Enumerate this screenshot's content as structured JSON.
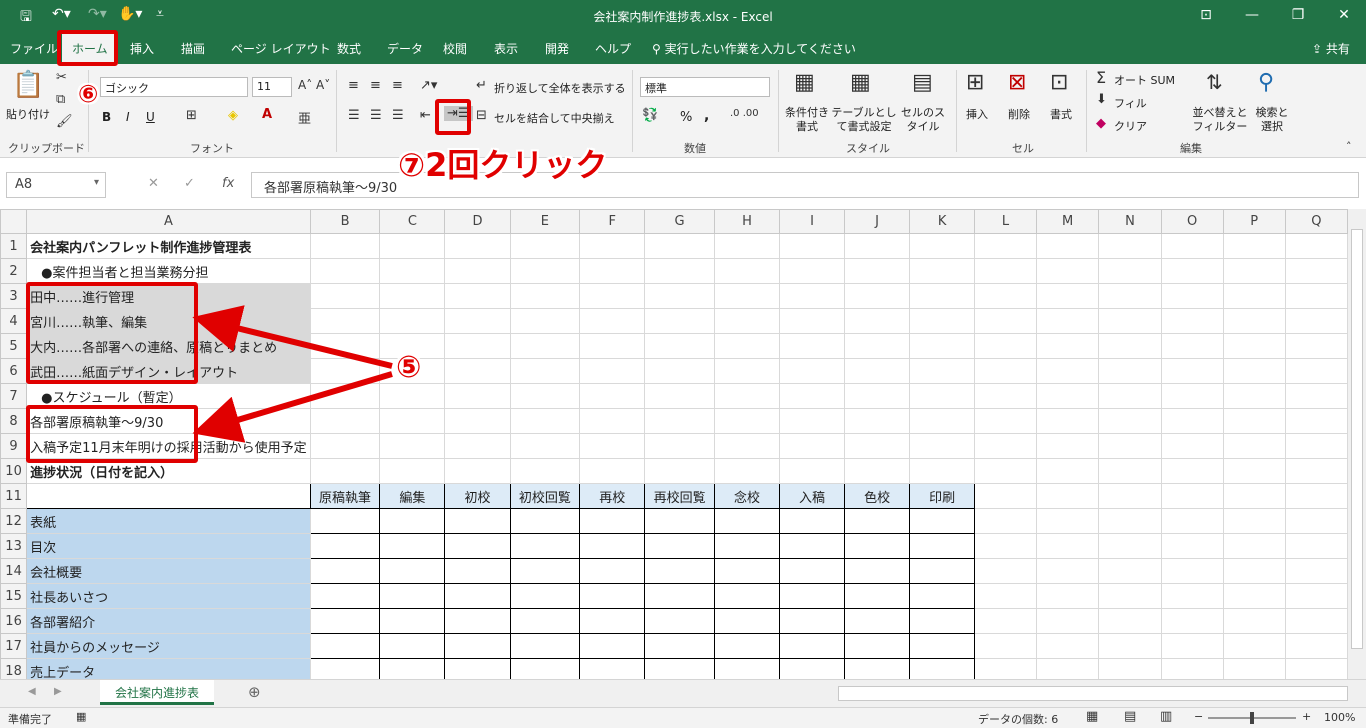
{
  "window": {
    "title": "会社案内制作進捗表.xlsx  -  Excel"
  },
  "menu": {
    "tabs": [
      "ファイル",
      "ホーム",
      "挿入",
      "描画",
      "ページ レイアウト",
      "数式",
      "データ",
      "校閲",
      "表示",
      "開発",
      "ヘルプ"
    ],
    "tell_me": "実行したい作業を入力してください",
    "share": "共有"
  },
  "ribbon": {
    "clipboard": {
      "paste": "貼り付け",
      "group": "クリップボード"
    },
    "font": {
      "name": "ゴシック",
      "size": "11",
      "group": "フォント",
      "bold": "B",
      "italic": "I",
      "underline": "U"
    },
    "alignment": {
      "wrap": "折り返して全体を表示する",
      "merge": "セルを結合して中央揃え"
    },
    "number": {
      "format": "標準",
      "group": "数値",
      "percent": "%",
      "comma": ","
    },
    "styles": {
      "conditional": "条件付き書式",
      "table": "テーブルとして書式設定",
      "cell": "セルのスタイル",
      "group": "スタイル"
    },
    "cells": {
      "insert": "挿入",
      "delete": "削除",
      "format": "書式",
      "group": "セル"
    },
    "editing": {
      "autosum": "オート SUM",
      "fill": "フィル",
      "clear": "クリア",
      "sort": "並べ替えとフィルター",
      "find": "検索と選択",
      "group": "編集"
    }
  },
  "formula": {
    "namebox": "A8",
    "fx": "fx",
    "content": "各部署原稿執筆～9/30"
  },
  "columns": [
    "A",
    "B",
    "C",
    "D",
    "E",
    "F",
    "G",
    "H",
    "I",
    "J",
    "K",
    "L",
    "M",
    "N",
    "O",
    "P",
    "Q"
  ],
  "rows": [
    {
      "n": "1",
      "a": "会社案内パンフレット制作進捗管理表"
    },
    {
      "n": "2",
      "a": "●案件担当者と担当業務分担"
    },
    {
      "n": "3",
      "a": "田中……進行管理"
    },
    {
      "n": "4",
      "a": "宮川……執筆、編集"
    },
    {
      "n": "5",
      "a": "大内……各部署への連絡、原稿とりまとめ"
    },
    {
      "n": "6",
      "a": "武田……紙面デザイン・レイアウト"
    },
    {
      "n": "7",
      "a": "●スケジュール（暫定）"
    },
    {
      "n": "8",
      "a": "各部署原稿執筆～9/30"
    },
    {
      "n": "9",
      "a": "入稿予定11月末年明けの採用活動から使用予定"
    },
    {
      "n": "10",
      "a": "進捗状況（日付を記入）"
    },
    {
      "n": "11",
      "a": ""
    },
    {
      "n": "12",
      "a": "表紙"
    },
    {
      "n": "13",
      "a": "目次"
    },
    {
      "n": "14",
      "a": "会社概要"
    },
    {
      "n": "15",
      "a": "社長あいさつ"
    },
    {
      "n": "16",
      "a": "各部署紹介"
    },
    {
      "n": "17",
      "a": "社員からのメッセージ"
    },
    {
      "n": "18",
      "a": "売上データ"
    }
  ],
  "progress_headers": [
    "原稿執筆",
    "編集",
    "初校",
    "初校回覧",
    "再校",
    "再校回覧",
    "念校",
    "入稿",
    "色校",
    "印刷"
  ],
  "sheet": {
    "tab": "会社案内進捗表"
  },
  "status": {
    "ready": "準備完了",
    "count": "データの個数: 6",
    "zoom": "100%"
  },
  "annotations": {
    "step5": "⑤",
    "step6": "⑥",
    "step7": "⑦2回クリック"
  }
}
